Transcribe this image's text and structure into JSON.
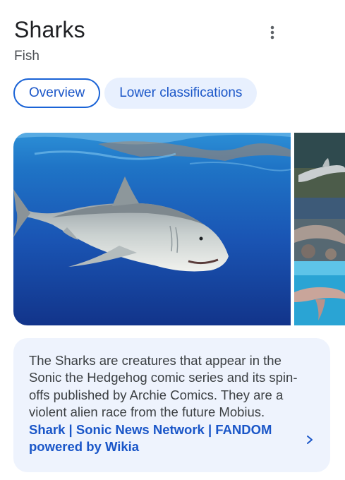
{
  "header": {
    "title": "Sharks",
    "subtitle": "Fish",
    "more_icon": "more-vert-icon"
  },
  "tabs": [
    {
      "label": "Overview",
      "selected": true
    },
    {
      "label": "Lower classifications",
      "selected": false
    }
  ],
  "images": {
    "main_icon": "great-white-shark-photo",
    "side_icons": [
      "shark-seafloor-photo",
      "shark-rocks-photo",
      "shark-turquoise-water-photo"
    ]
  },
  "snippet": {
    "text": "The Sharks are creatures that appear in the Sonic the Hedgehog comic series and its spin-offs published by Archie Comics. They are a violent alien race from the future Mobius.",
    "source_link": "Shark | Sonic News Network | FANDOM powered by Wikia",
    "chevron_icon": "chevron-right-icon"
  },
  "colors": {
    "link_blue": "#1a56c8",
    "chip_border": "#1a63d6",
    "chip_bg": "#e8f0fe",
    "snippet_bg": "#eef3fd"
  }
}
